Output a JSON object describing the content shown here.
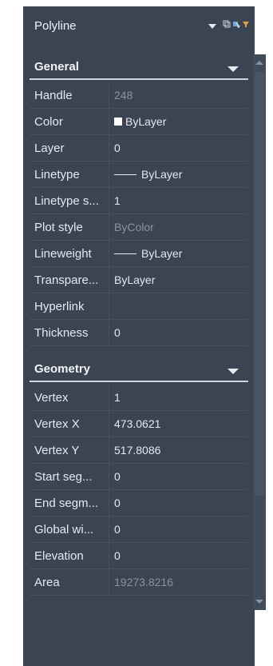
{
  "header": {
    "title": "Polyline"
  },
  "colors": {
    "panel_bg": "#3b4453",
    "text": "#e6e9ee",
    "muted_text": "#8a93a0"
  },
  "sections": {
    "general": {
      "label": "General",
      "rows": [
        {
          "key": "Handle",
          "value": "248"
        },
        {
          "key": "Color",
          "value": "ByLayer"
        },
        {
          "key": "Layer",
          "value": "0"
        },
        {
          "key": "Linetype",
          "value": "ByLayer"
        },
        {
          "key": "Linetype s...",
          "value": "1"
        },
        {
          "key": "Plot style",
          "value": "ByColor"
        },
        {
          "key": "Lineweight",
          "value": "ByLayer"
        },
        {
          "key": "Transpare...",
          "value": "ByLayer"
        },
        {
          "key": "Hyperlink",
          "value": ""
        },
        {
          "key": "Thickness",
          "value": "0"
        }
      ]
    },
    "geometry": {
      "label": "Geometry",
      "rows": [
        {
          "key": "Vertex",
          "value": "1"
        },
        {
          "key": "Vertex X",
          "value": "473.0621"
        },
        {
          "key": "Vertex Y",
          "value": "517.8086"
        },
        {
          "key": "Start seg...",
          "value": "0"
        },
        {
          "key": "End segm...",
          "value": "0"
        },
        {
          "key": "Global wi...",
          "value": "0"
        },
        {
          "key": "Elevation",
          "value": "0"
        },
        {
          "key": "Area",
          "value": "19273.8216"
        }
      ]
    }
  }
}
